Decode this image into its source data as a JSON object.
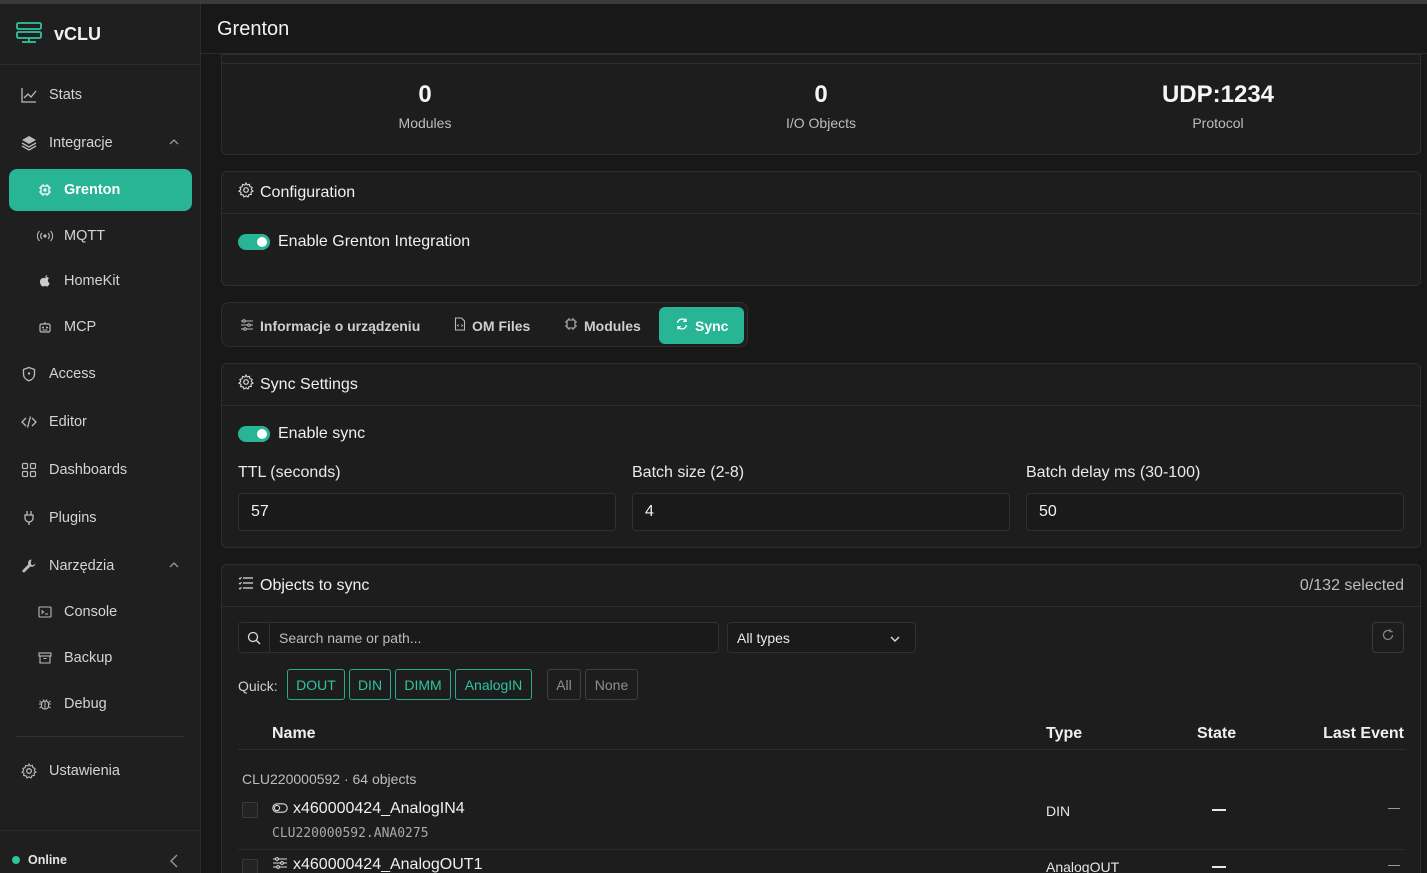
{
  "app": {
    "name": "vCLU"
  },
  "sidebar": {
    "items": [
      {
        "label": "Stats",
        "icon": "chart-line-icon"
      },
      {
        "label": "Integracje",
        "icon": "layers-icon"
      },
      {
        "label": "Grenton",
        "icon": "chip-icon"
      },
      {
        "label": "MQTT",
        "icon": "broadcast-icon"
      },
      {
        "label": "HomeKit",
        "icon": "apple-icon"
      },
      {
        "label": "MCP",
        "icon": "robot-icon"
      },
      {
        "label": "Access",
        "icon": "shield-icon"
      },
      {
        "label": "Editor",
        "icon": "code-icon"
      },
      {
        "label": "Dashboards",
        "icon": "grid-icon"
      },
      {
        "label": "Plugins",
        "icon": "plug-icon"
      },
      {
        "label": "Narzędzia",
        "icon": "wrench-icon"
      },
      {
        "label": "Console",
        "icon": "terminal-icon"
      },
      {
        "label": "Backup",
        "icon": "archive-icon"
      },
      {
        "label": "Debug",
        "icon": "bug-icon"
      },
      {
        "label": "Ustawienia",
        "icon": "gear-icon"
      }
    ],
    "status": "Online"
  },
  "header": {
    "title": "Grenton"
  },
  "stats": [
    {
      "value": "0",
      "label": "Modules"
    },
    {
      "value": "0",
      "label": "I/O Objects"
    },
    {
      "value": "UDP:1234",
      "label": "Protocol"
    }
  ],
  "config": {
    "title": "Configuration",
    "toggle_label": "Enable Grenton Integration",
    "enabled": true
  },
  "tabs": [
    {
      "label": "Informacje o urządzeniu",
      "icon": "sliders-icon"
    },
    {
      "label": "OM Files",
      "icon": "file-icon"
    },
    {
      "label": "Modules",
      "icon": "cpu-icon"
    },
    {
      "label": "Sync",
      "icon": "sync-icon"
    }
  ],
  "sync": {
    "title": "Sync Settings",
    "toggle_label": "Enable sync",
    "enabled": true,
    "fields": [
      {
        "label": "TTL (seconds)",
        "value": "57"
      },
      {
        "label": "Batch size (2-8)",
        "value": "4"
      },
      {
        "label": "Batch delay ms (30-100)",
        "value": "50"
      }
    ]
  },
  "objects": {
    "title": "Objects to sync",
    "selected": "0/132 selected",
    "search_placeholder": "Search name or path...",
    "type_filter": "All types",
    "quick_label": "Quick:",
    "quick": [
      "DOUT",
      "DIN",
      "DIMM",
      "AnalogIN"
    ],
    "quick_extra": [
      "All",
      "None"
    ],
    "columns": [
      "Name",
      "Type",
      "State",
      "Last Event"
    ],
    "group": "CLU220000592 · 64 objects",
    "rows": [
      {
        "name": "x460000424_AnalogIN4",
        "path": "CLU220000592.ANA0275",
        "type": "DIN",
        "icon": "toggle-icon"
      },
      {
        "name": "x460000424_AnalogOUT1",
        "path": "",
        "type": "AnalogOUT",
        "icon": "sliders-icon"
      }
    ]
  },
  "colors": {
    "accent": "#27b596",
    "background": "#181818",
    "panel": "#1d1d1d"
  }
}
